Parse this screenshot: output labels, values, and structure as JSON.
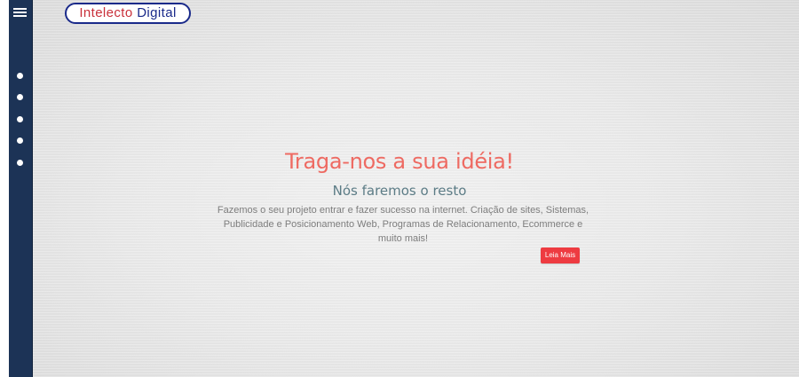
{
  "logo": {
    "word1": "Intelecto",
    "word2": "Digital"
  },
  "sidebar": {
    "menu_icon": "hamburger-icon",
    "nav_dots": 5
  },
  "hero": {
    "title": "Traga-nos a sua idéia!",
    "subtitle": "Nós faremos o resto",
    "text": "Fazemos o seu projeto entrar e fazer sucesso na internet. Criação de sites, Sistemas, Publicidade e Posicionamento Web, Programas de Relacionamento, Ecommerce e muito mais!",
    "button_label": "Leia Mais"
  },
  "colors": {
    "sidebar": "#1c3356",
    "title": "#ee6a62",
    "subtitle": "#5c7c86",
    "button": "#ee3b41",
    "logo_border": "#1a2a8a",
    "logo_red": "#c9303a"
  }
}
